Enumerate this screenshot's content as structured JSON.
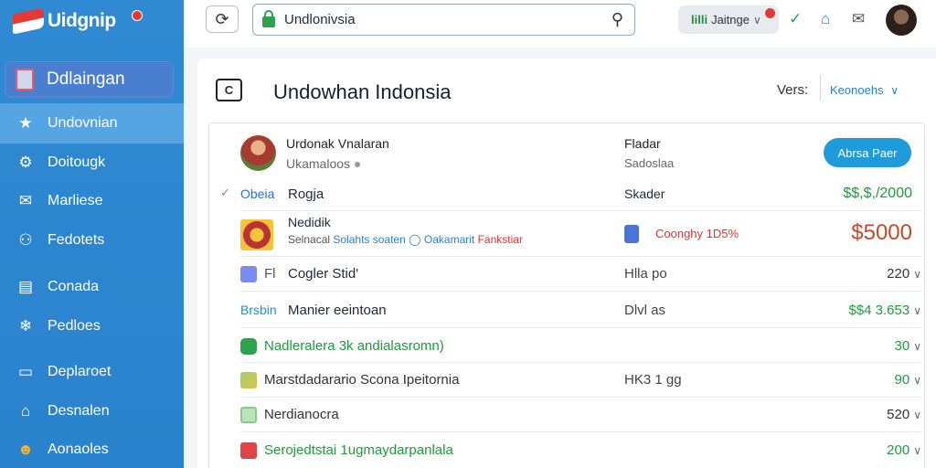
{
  "brand": {
    "name": "Uidgnip"
  },
  "sidebar": {
    "header": "Ddlaingan",
    "items": [
      {
        "label": "Undovnian",
        "icon": "star-icon",
        "glyph": "★",
        "active": true
      },
      {
        "label": "Doitougk",
        "icon": "gear-icon",
        "glyph": "⚙"
      },
      {
        "label": "Marliese",
        "icon": "mail-icon",
        "glyph": "✉"
      },
      {
        "label": "Fedotets",
        "icon": "chat-icon",
        "glyph": "⚇"
      },
      {
        "label": "Conada",
        "icon": "document-icon",
        "glyph": "▤"
      },
      {
        "label": "Pedloes",
        "icon": "snowflake-icon",
        "glyph": "❄"
      },
      {
        "label": "Deplaroet",
        "icon": "screen-icon",
        "glyph": "▭"
      },
      {
        "label": "Desnalen",
        "icon": "inbox-icon",
        "glyph": "⌂"
      },
      {
        "label": "Aonaoles",
        "icon": "face-icon",
        "glyph": "☻"
      }
    ]
  },
  "topbar": {
    "search_value": "Undlonivsia",
    "pill_label": "Jaitnge",
    "pill_prefix": "lilli"
  },
  "main": {
    "title": "Undowhan Indonsia",
    "vers_label": "Vers:",
    "version_select": "Keonoehs",
    "title_icon": "C"
  },
  "table": {
    "profile": {
      "name": "Urdonak Vnalaran",
      "sub": "Ukamaloos",
      "mid_label": "Fladar",
      "mid_sub": "Sadoslaa",
      "button": "Abrsa Paer"
    },
    "rows": [
      {
        "prefix": "Obeia",
        "label": "Rogja",
        "mid": "Skader",
        "amount": "$$,$,/2000"
      },
      {
        "title": "Nedidik",
        "sub1": "Selnacal",
        "sub2": "Solahts soaten",
        "sub3": "Oakamarit",
        "sub4": "Fankstiar",
        "mid": "Coonghy 1D5%",
        "amount": "$5000"
      },
      {
        "icon_label": "Fl",
        "label": "Cogler Stid'",
        "mid": "Hlla po",
        "amount": "220"
      },
      {
        "prefix": "Brsbin",
        "label": "Manier eeintoan",
        "mid": "Dlvl as",
        "amount": "$$4 3.653"
      },
      {
        "label": "Nadleralera 3k andialasromn)",
        "amount": "30"
      },
      {
        "label": "Marstdadarario Scona Ipeitornia",
        "mid": "HK3 1 gg",
        "amount": "90"
      },
      {
        "label": "Nerdianocra",
        "amount": "520"
      },
      {
        "label": "Serojedtstai 1ugmaydarpanlala",
        "amount": "200"
      }
    ]
  }
}
